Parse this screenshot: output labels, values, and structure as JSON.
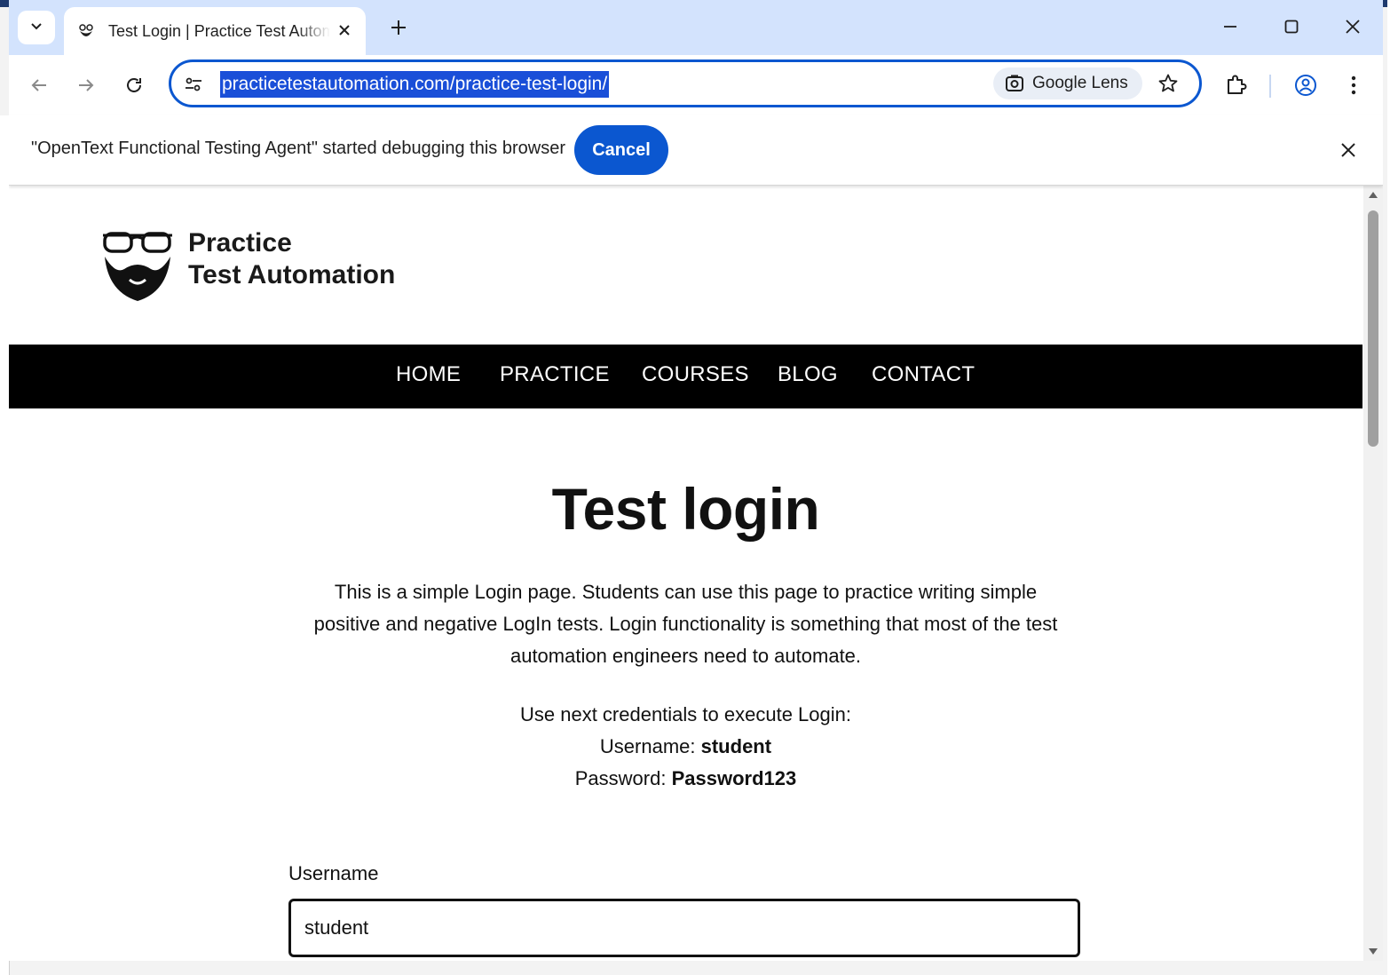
{
  "browser": {
    "tab_title": "Test Login | Practice Test Automation",
    "url": "practicetestautomation.com/practice-test-login/",
    "google_lens_label": "Google Lens",
    "icons": [
      "tab-search-icon",
      "favicon-icon",
      "close-tab-icon",
      "new-tab-icon",
      "minimize-icon",
      "maximize-icon",
      "close-window-icon",
      "back-icon",
      "forward-icon",
      "reload-icon",
      "site-info-icon",
      "google-lens-icon",
      "bookmark-star-icon",
      "extensions-icon",
      "profile-icon",
      "menu-icon"
    ]
  },
  "infobar": {
    "message": "\"OpenText Functional Testing Agent\" started debugging this browser",
    "cancel_label": "Cancel"
  },
  "site": {
    "logo_line1": "Practice",
    "logo_line2": "Test Automation",
    "nav": [
      "HOME",
      "PRACTICE",
      "COURSES",
      "BLOG",
      "CONTACT"
    ]
  },
  "content": {
    "title": "Test login",
    "intro": "This is a simple Login page. Students can use this page to practice writing simple positive and negative LogIn tests. Login functionality is something that most of the test automation engineers need to automate.",
    "creds_heading": "Use next credentials to execute Login:",
    "username_label": "Username:",
    "username_value": "student",
    "password_label": "Password:",
    "password_value": "Password123"
  },
  "form": {
    "username_field_label": "Username",
    "username_field_value": "student"
  },
  "colors": {
    "accent": "#0b57d0",
    "tabstrip": "#d3e3fd",
    "navbar": "#000000"
  }
}
